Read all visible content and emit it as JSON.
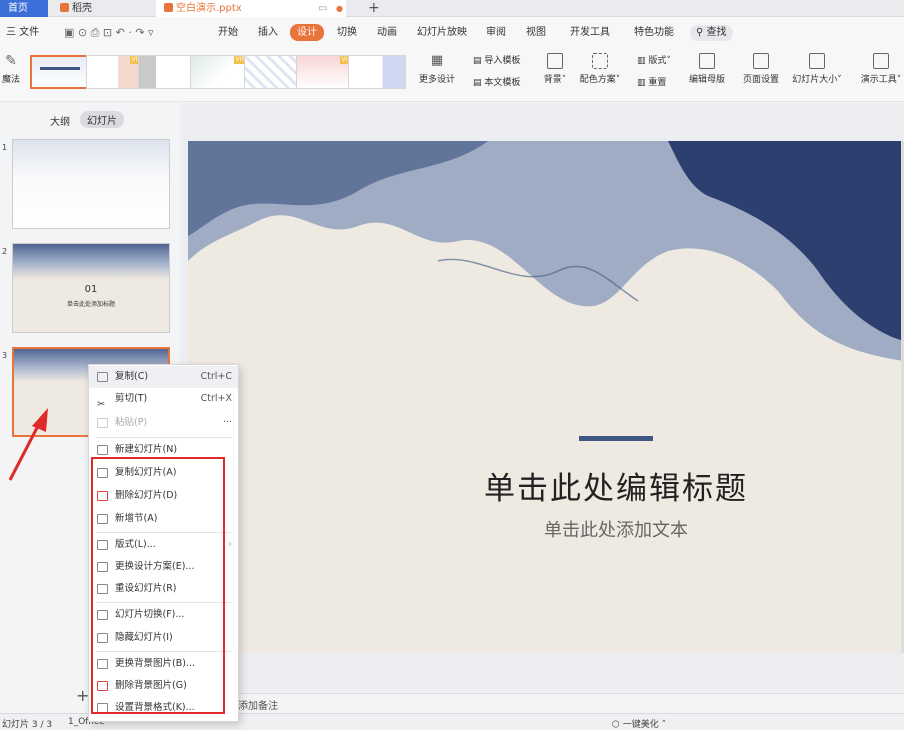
{
  "tabs": {
    "home": "首页",
    "docer": "稻壳",
    "file": "空白演示.pptx",
    "plus": "+"
  },
  "menu": {
    "file": "三 文件",
    "items": [
      "开始",
      "插入",
      "设计",
      "切换",
      "动画",
      "幻灯片放映",
      "审阅",
      "视图",
      "开发工具",
      "特色功能"
    ],
    "active": "设计",
    "search": "查找"
  },
  "ribbon": {
    "magic": "魔法",
    "vip": "VIP",
    "more_design": "更多设计",
    "import_template": "导入模板",
    "this_template": "本文模板",
    "background": "背景",
    "color_scheme": "配色方案",
    "layout": "版式",
    "reset": "重置",
    "edit_master": "编辑母版",
    "page_setup": "页面设置",
    "slide_size": "幻灯片大小",
    "present_tools": "演示工具"
  },
  "panel": {
    "outline_tab": "大纲",
    "slides_tab": "幻灯片",
    "thumb2_num": "01",
    "thumb2_title": "单击此处添加标题"
  },
  "slide": {
    "title": "单击此处编辑标题",
    "subtitle": "单击此处添加文本"
  },
  "context_menu": {
    "copy": "复制(C)",
    "copy_key": "Ctrl+C",
    "cut": "剪切(T)",
    "cut_key": "Ctrl+X",
    "paste": "粘贴(P)",
    "paste_key": "···",
    "new_slide": "新建幻灯片(N)",
    "dup_slide": "复制幻灯片(A)",
    "del_slide": "删除幻灯片(D)",
    "new_section": "新增节(A)",
    "layout": "版式(L)...",
    "change_design": "更换设计方案(E)...",
    "reset_slide": "重设幻灯片(R)",
    "transition": "幻灯片切换(F)...",
    "hide_slide": "隐藏幻灯片(I)",
    "change_bg_img": "更换背景图片(B)...",
    "del_bg_img": "删除背景图片(G)",
    "set_bg_format": "设置背景格式(K)..."
  },
  "notes": {
    "placeholder": "添加备注"
  },
  "status": {
    "slide_count": "幻灯片 3 / 3",
    "theme": "1_Office",
    "beautify": "一键美化"
  },
  "colors": {
    "accent": "#e8743a",
    "home_tab": "#3d6fd9",
    "highlight_box": "#e02a2a",
    "ink": "#3e5684"
  }
}
